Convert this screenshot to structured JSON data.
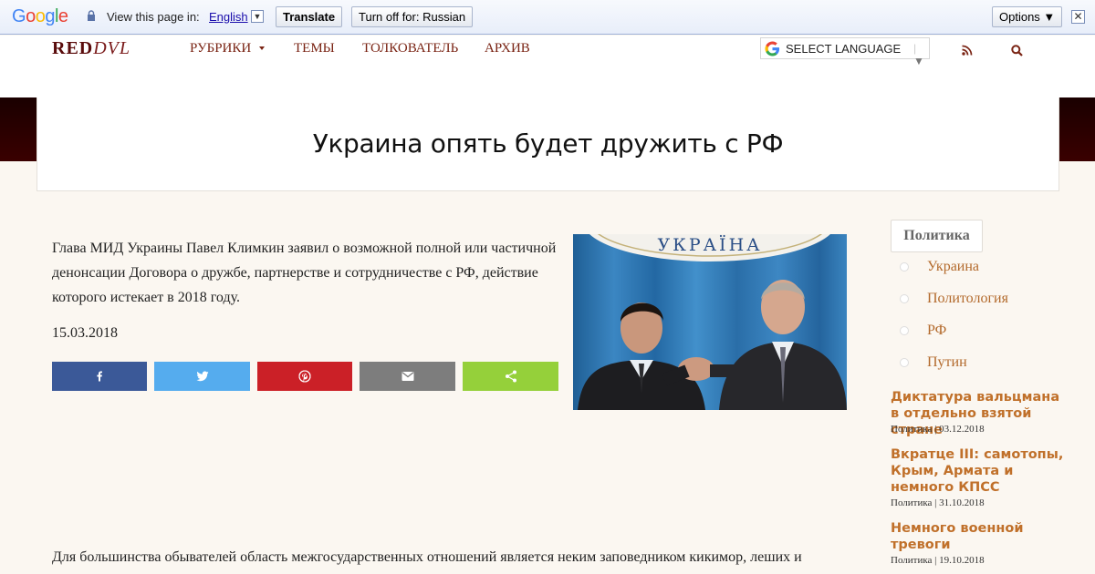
{
  "translate_bar": {
    "logo": "Google",
    "view_text": "View this page in:",
    "language": "English",
    "translate_button": "Translate",
    "turnoff_button": "Turn off for: Russian",
    "options_button": "Options ▼",
    "close": "✕"
  },
  "header": {
    "logo_red": "RED",
    "logo_dvl": "DVL",
    "nav": [
      "РУБРИКИ",
      "ТЕМЫ",
      "ТОЛКОВАТЕЛЬ",
      "АРХИВ"
    ],
    "select_language": "SELECT LANGUAGE",
    "select_arrow": "▼"
  },
  "article": {
    "title": "Украина опять будет дружить с РФ",
    "lead": "Глава МИД Украины Павел Климкин заявил о возможной полной или частичной денонсации Договора о дружбе, партнерстве и сотрудничестве с РФ, действие которого истекает в 2018 году.",
    "date": "15.03.2018",
    "photo_sign_text": "УКРАЇНА",
    "body_start": "Для большинства обывателей область межгосударственных отношений является неким заповедником кикимор, леших и"
  },
  "sidebar": {
    "category": "Политика",
    "tags": [
      "Украина",
      "Политология",
      "РФ",
      "Путин"
    ],
    "posts": [
      {
        "title": "Диктатура вальцмана в отдельно взятой стране",
        "meta": "Политика | 03.12.2018"
      },
      {
        "title": "Вкратце III: самотопы, Крым, Армата и немного КПСС",
        "meta": "Политика | 31.10.2018"
      },
      {
        "title": "Немного военной тревоги",
        "meta": "Политика | 19.10.2018"
      }
    ]
  },
  "colors": {
    "facebook": "#3b5998",
    "twitter": "#55acee",
    "pinterest": "#cb2027",
    "email": "#7d7d7d",
    "share": "#95d03a",
    "accent": "#c0702a"
  }
}
